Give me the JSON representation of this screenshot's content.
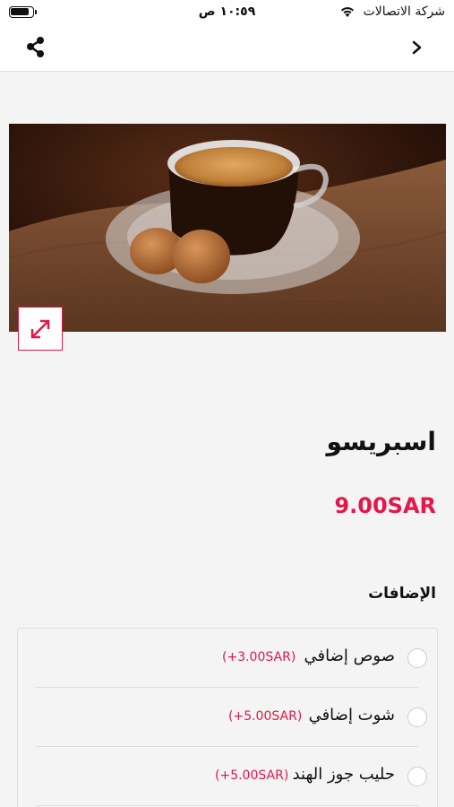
{
  "status_bar": {
    "carrier": "شركة الاتصالات",
    "time": "١٠:٥٩ ص"
  },
  "nav": {
    "share_icon": "share-icon",
    "back_icon": "chevron-right-icon"
  },
  "product": {
    "name": "اسبريسو",
    "price": "9.00SAR",
    "image_alt": "Espresso cup with cookies"
  },
  "addons": {
    "title": "الإضافات",
    "items": [
      {
        "name": "صوص إضافي",
        "price": "(+3.00SAR)"
      },
      {
        "name": "شوت إضافي",
        "price": "(+5.00SAR)"
      },
      {
        "name": "حليب جوز الهند",
        "price": "(+5.00SAR)"
      }
    ]
  },
  "colors": {
    "accent": "#e3174a",
    "background": "#f4f4f4"
  }
}
